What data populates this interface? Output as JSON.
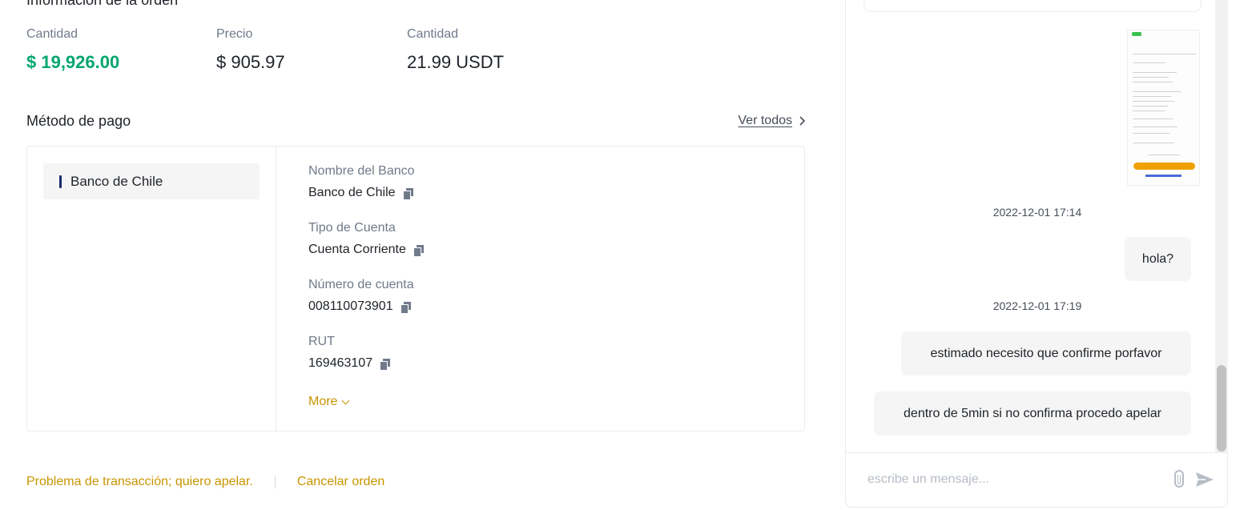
{
  "order": {
    "title": "Información de la orden",
    "amount_label": "Cantidad",
    "amount_value": "$ 19,926.00",
    "price_label": "Precio",
    "price_value": "$ 905.97",
    "quantity_label": "Cantidad",
    "quantity_value": "21.99 USDT"
  },
  "payment": {
    "title": "Método de pago",
    "see_all": "Ver todos",
    "bank_tab": "Banco de Chile",
    "fields": [
      {
        "label": "Nombre del Banco",
        "value": "Banco de Chile"
      },
      {
        "label": "Tipo de Cuenta",
        "value": "Cuenta Corriente"
      },
      {
        "label": "Número de cuenta",
        "value": "008110073901"
      },
      {
        "label": "RUT",
        "value": "169463107"
      }
    ],
    "more": "More"
  },
  "actions": {
    "appeal": "Problema de transacción; quiero apelar.",
    "cancel": "Cancelar orden"
  },
  "chat": {
    "messages": [
      {
        "type": "timestamp",
        "text": "2022-12-01 17:14"
      },
      {
        "type": "bubble",
        "text": "hola?"
      },
      {
        "type": "timestamp",
        "text": "2022-12-01 17:19"
      },
      {
        "type": "bubble",
        "text": "estimado necesito que confirme porfavor"
      },
      {
        "type": "bubble",
        "text": "dentro de 5min si no confirma procedo apelar"
      }
    ],
    "input_placeholder": "escribe un mensaje..."
  },
  "icons": [
    "copy-icon",
    "chevron-right-icon",
    "chevron-down-icon",
    "paperclip-icon",
    "send-icon"
  ],
  "colors": {
    "accent": "#c99400",
    "green": "#03a66d",
    "bank_bar": "#1a2b6b"
  }
}
